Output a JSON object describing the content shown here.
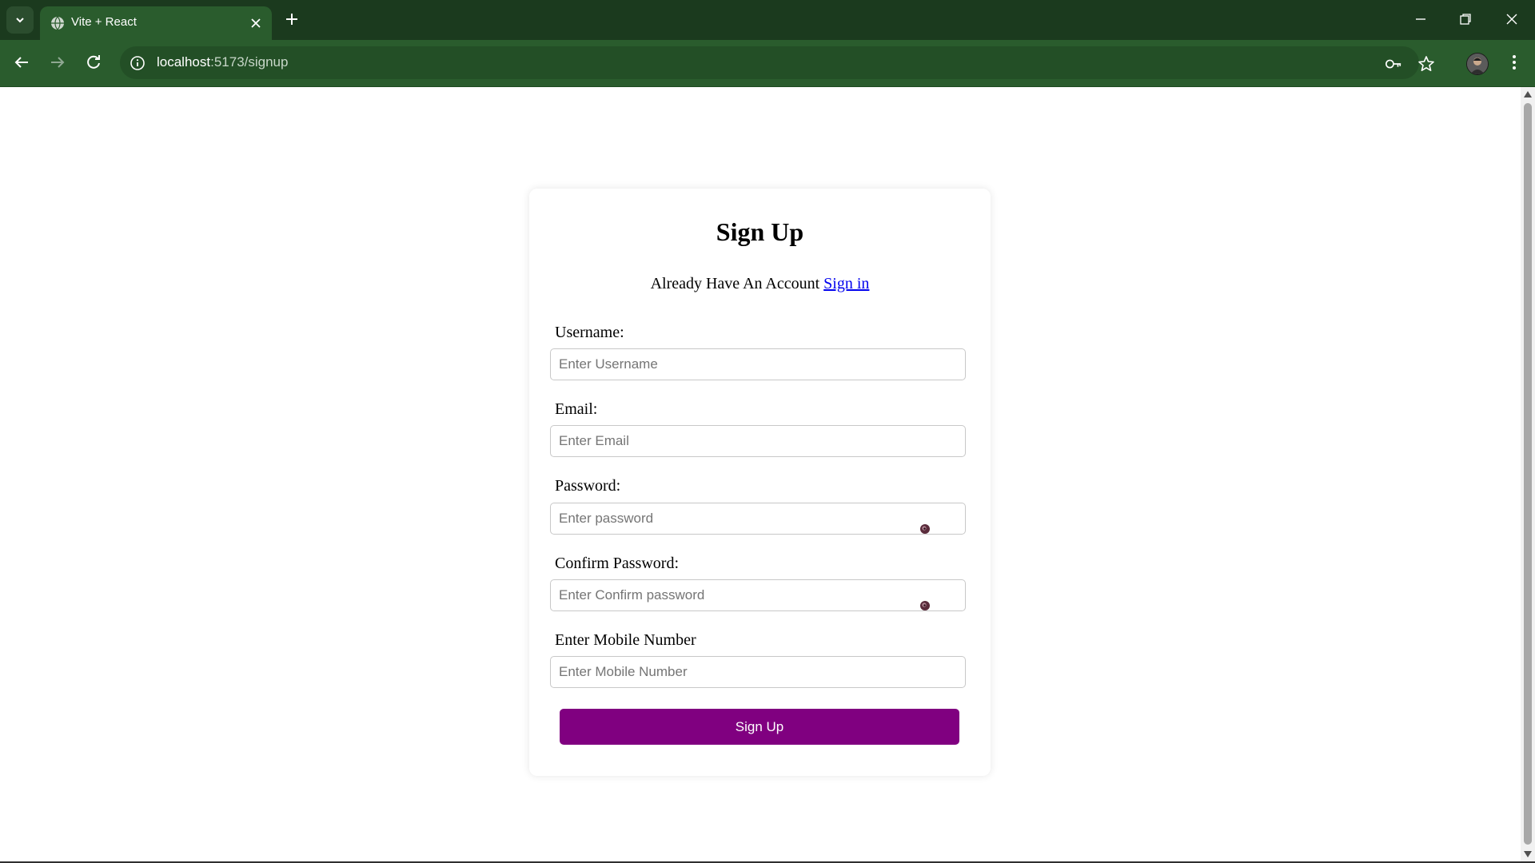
{
  "browser": {
    "tab_title": "Vite + React",
    "url_host": "localhost",
    "url_path": ":5173/signup"
  },
  "page": {
    "title": "Sign Up",
    "account_prompt": "Already Have An Account",
    "signin_link": "Sign in",
    "fields": {
      "username": {
        "label": "Username:",
        "placeholder": "Enter Username"
      },
      "email": {
        "label": "Email:",
        "placeholder": "Enter Email"
      },
      "password": {
        "label": "Password:",
        "placeholder": "Enter password"
      },
      "confirm_password": {
        "label": "Confirm Password:",
        "placeholder": "Enter Confirm password"
      },
      "mobile": {
        "label": "Enter Mobile Number",
        "placeholder": "Enter Mobile Number"
      }
    },
    "submit_label": "Sign Up"
  },
  "colors": {
    "chrome_frame": "#1b3a1e",
    "chrome_toolbar": "#2a5c2d",
    "button_primary": "#800080",
    "link": "#0000ee"
  },
  "icons": {
    "tab_search": "chevron-down-icon",
    "favicon": "globe-icon",
    "tab_close": "close-icon",
    "new_tab": "plus-icon",
    "back": "arrow-left-icon",
    "forward": "arrow-right-icon",
    "reload": "reload-icon",
    "site_info": "info-icon",
    "password_manager": "key-icon",
    "bookmark": "star-icon",
    "menu": "kebab-menu-icon",
    "password_toggle": "eye-icon"
  }
}
